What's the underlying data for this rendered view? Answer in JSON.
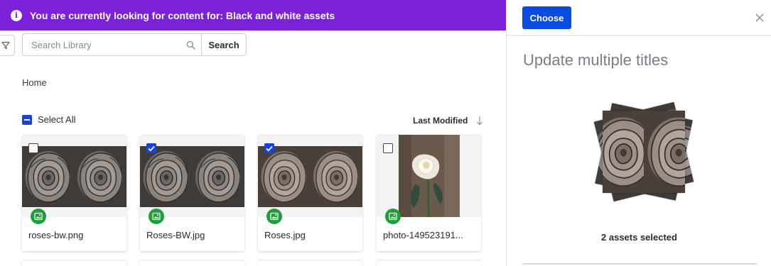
{
  "banner": {
    "text": "You are currently looking for content for: Black and white assets",
    "icon": "info-icon",
    "color": "#7b21d9"
  },
  "toolbar": {
    "filter_icon": "filter-icon",
    "search_placeholder": "Search Library",
    "search_value": "",
    "search_button": "Search"
  },
  "breadcrumb": "Home",
  "select_all": {
    "label": "Select All",
    "state": "indeterminate"
  },
  "sort": {
    "label": "Last Modified",
    "icon": "arrow-down-icon"
  },
  "assets": [
    {
      "name": "roses-bw.png",
      "checked": false,
      "type_icon": "image-icon",
      "tone": "bw"
    },
    {
      "name": "Roses-BW.jpg",
      "checked": true,
      "type_icon": "image-icon",
      "tone": "bw"
    },
    {
      "name": "Roses.jpg",
      "checked": true,
      "type_icon": "image-icon",
      "tone": "sepia"
    },
    {
      "name": "photo-149523191...",
      "checked": false,
      "type_icon": "image-icon",
      "tone": "white-rose"
    }
  ],
  "panel": {
    "choose_button": "Choose",
    "close_icon": "close-icon",
    "title": "Update multiple titles",
    "selected_count": "2 assets selected"
  },
  "colors": {
    "accent_blue": "#1445d6",
    "choose_blue": "#0a4be0",
    "image_badge_green": "#1e9e3a"
  }
}
